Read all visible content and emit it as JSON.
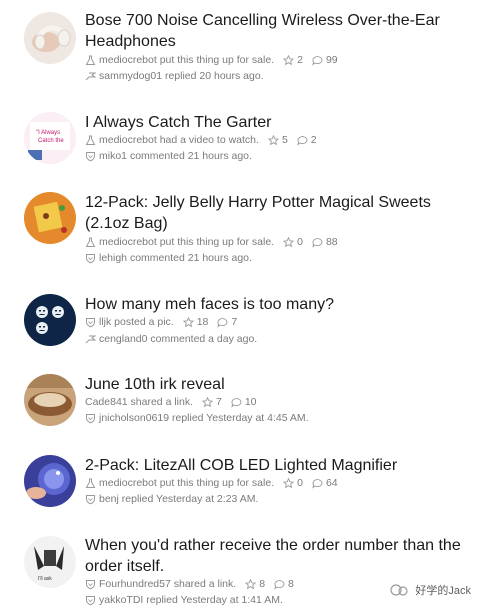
{
  "items": [
    {
      "title": "Bose 700 Noise Cancelling Wireless Over-the-Ear Headphones",
      "action_user": "mediocrebot",
      "action_text": "put this thing up for sale.",
      "stars": "2",
      "comments": "99",
      "action_icon": "flask-icon",
      "reply_user": "sammydog01",
      "reply_text": "replied 20 hours ago.",
      "reply_icon": "flag-icon"
    },
    {
      "title": "I Always Catch The Garter",
      "action_user": "mediocrebot",
      "action_text": "had a video to watch.",
      "stars": "5",
      "comments": "2",
      "action_icon": "flask-icon",
      "reply_user": "miko1",
      "reply_text": "commented 21 hours ago.",
      "reply_icon": "shield-icon"
    },
    {
      "title": "12-Pack: Jelly Belly Harry Potter Magical Sweets (2.1oz Bag)",
      "action_user": "mediocrebot",
      "action_text": "put this thing up for sale.",
      "stars": "0",
      "comments": "88",
      "action_icon": "flask-icon",
      "reply_user": "lehigh",
      "reply_text": "commented 21 hours ago.",
      "reply_icon": "shield-icon"
    },
    {
      "title": "How many meh faces is too many?",
      "action_user": "lljk",
      "action_text": "posted a pic.",
      "stars": "18",
      "comments": "7",
      "action_icon": "shield-icon",
      "reply_user": "cengland0",
      "reply_text": "commented a day ago.",
      "reply_icon": "flag-icon"
    },
    {
      "title": "June 10th irk reveal",
      "action_user": "Cade841",
      "action_text": "shared a link.",
      "stars": "7",
      "comments": "10",
      "action_icon": "",
      "reply_user": "jnicholson0619",
      "reply_text": "replied Yesterday at 4:45 AM.",
      "reply_icon": "shield-icon"
    },
    {
      "title": "2-Pack: LitezAll COB LED Lighted Magnifier",
      "action_user": "mediocrebot",
      "action_text": "put this thing up for sale.",
      "stars": "0",
      "comments": "64",
      "action_icon": "flask-icon",
      "reply_user": "benj",
      "reply_text": "replied Yesterday at 2:23 AM.",
      "reply_icon": "shield-icon"
    },
    {
      "title": "When you'd rather receive the order number than the order itself.",
      "action_user": "Fourhundred57",
      "action_text": "shared a link.",
      "stars": "8",
      "comments": "8",
      "action_icon": "shield-icon",
      "reply_user": "yakkoTDI",
      "reply_text": "replied Yesterday at 1:41 AM.",
      "reply_icon": "shield-icon"
    }
  ],
  "watermark": "好学的Jack",
  "colors": {
    "meta": "#7b7b7b",
    "title": "#1b1b1b",
    "icon": "#9a9a9a"
  }
}
